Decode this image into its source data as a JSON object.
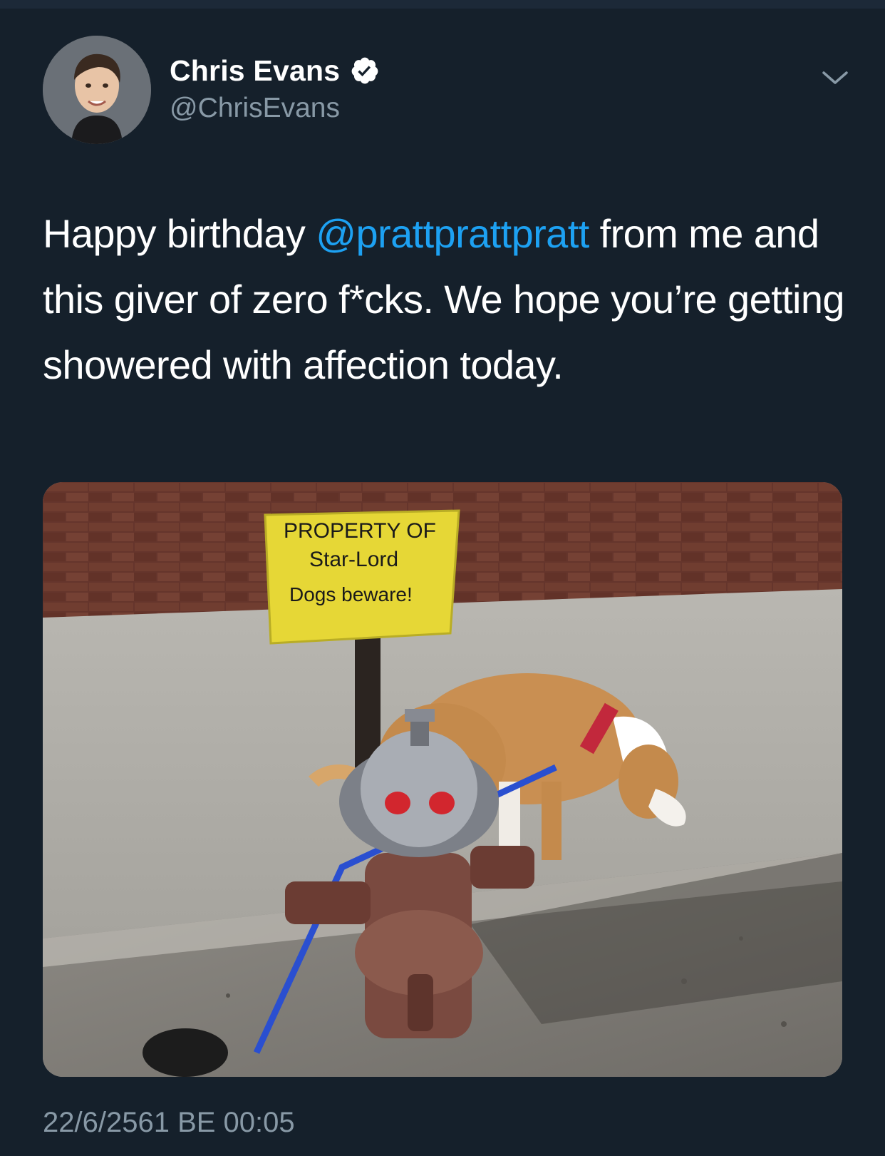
{
  "tweet": {
    "author_name": "Chris Evans",
    "author_handle": "@ChrisEvans",
    "text_before_mention": "Happy birthday ",
    "mention": "@prattprattpratt",
    "text_after_mention": " from me and this giver of zero f*cks. We hope you’re getting showered with affection today.",
    "timestamp": "22/6/2561 BE 00:05"
  },
  "media": {
    "sign_line1": "PROPERTY OF",
    "sign_line2": "Star-Lord",
    "sign_line3": "Dogs beware!"
  },
  "icons": {
    "verified": "verified-badge-icon",
    "more": "chevron-down-icon"
  },
  "colors": {
    "background": "#15202b",
    "mention": "#1da1f2",
    "secondary_text": "#8899a6"
  }
}
